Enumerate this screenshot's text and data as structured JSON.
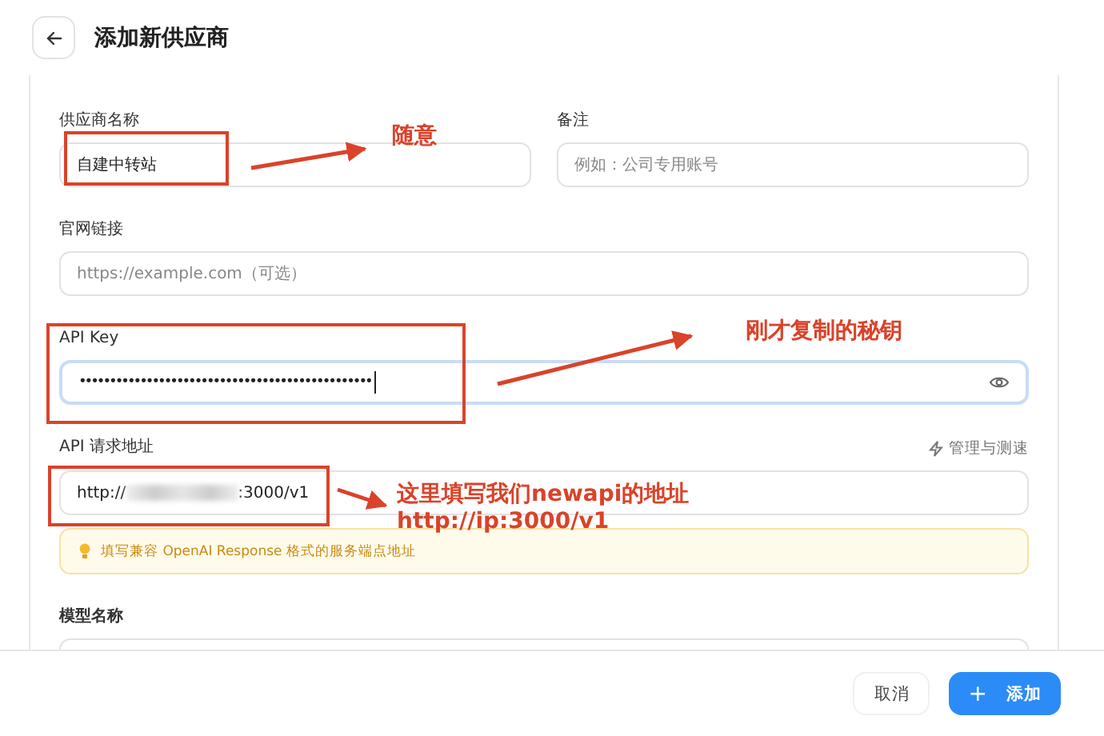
{
  "header": {
    "title": "添加新供应商"
  },
  "form": {
    "name": {
      "label": "供应商名称",
      "value": "自建中转站"
    },
    "note": {
      "label": "备注",
      "placeholder": "例如：公司专用账号"
    },
    "website": {
      "label": "官网链接",
      "placeholder": "https://example.com（可选）"
    },
    "api_key": {
      "label": "API Key",
      "value": "••••••••••••••••••••••••••••••••••••••••••••••••"
    },
    "endpoint": {
      "label": "API 请求地址",
      "action": "管理与测速",
      "value_start": "http://",
      "value_end": ":3000/v1",
      "hint": "填写兼容 OpenAI Response 格式的服务端点地址"
    },
    "model": {
      "label": "模型名称"
    }
  },
  "footer": {
    "cancel": "取消",
    "add_icon": "+",
    "add": "添加"
  },
  "annotations": [
    {
      "text": "随意"
    },
    {
      "text": "刚才复制的秘钥"
    },
    {
      "text": "这里填写我们newapi的地址"
    },
    {
      "text": "http://ip:3000/v1"
    }
  ]
}
